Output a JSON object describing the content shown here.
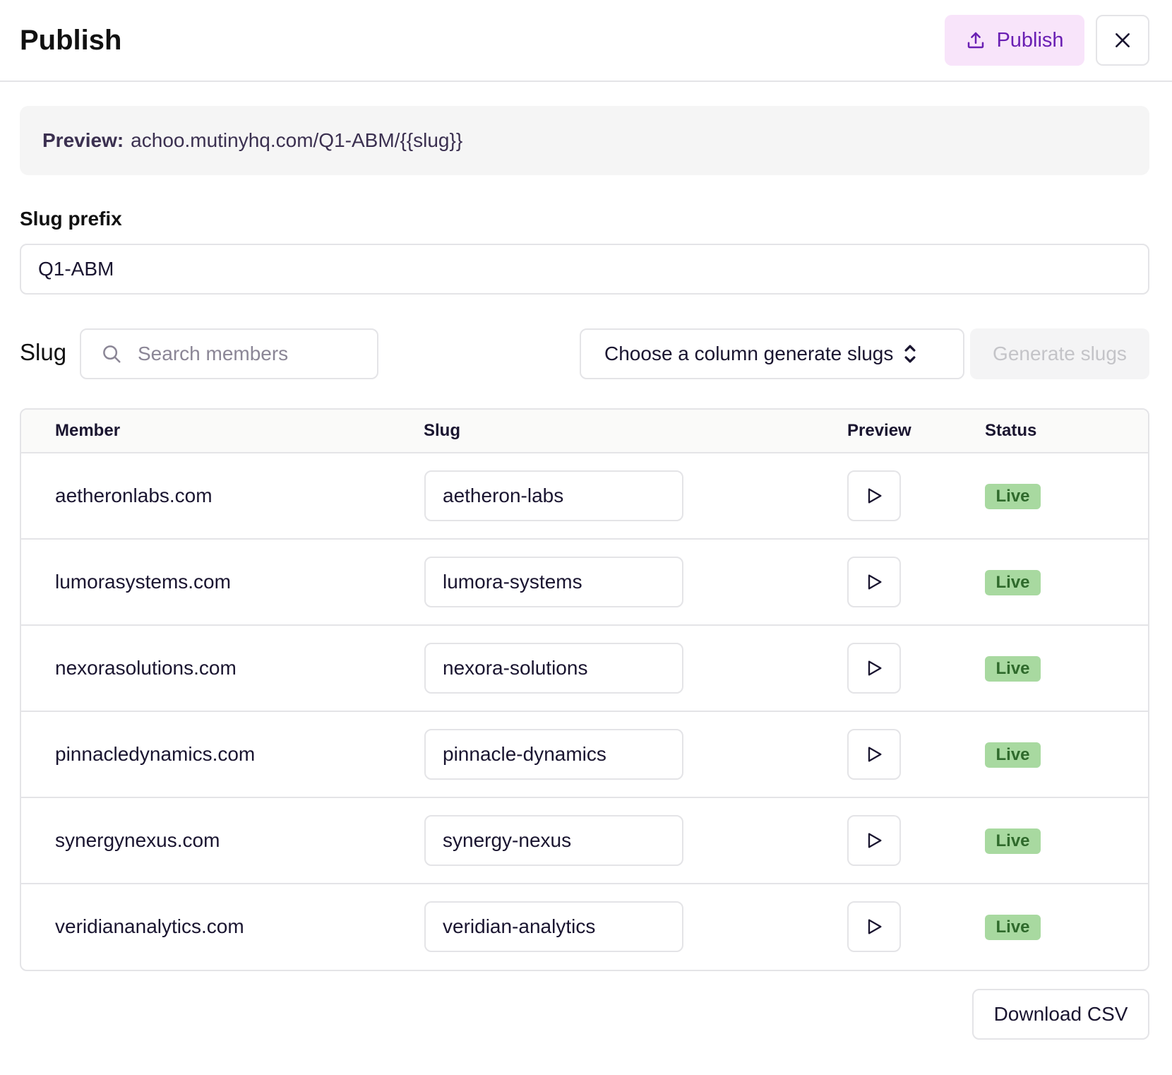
{
  "header": {
    "title": "Publish",
    "publish_label": "Publish",
    "publish_icon": "upload-icon",
    "close_icon": "close-icon"
  },
  "preview": {
    "label": "Preview:",
    "url": "achoo.mutinyhq.com/Q1-ABM/{{slug}}"
  },
  "slug_prefix": {
    "label": "Slug prefix",
    "value": "Q1-ABM"
  },
  "slug_toolbar": {
    "label": "Slug",
    "search_placeholder": "Search members",
    "search_icon": "search-icon",
    "column_select_label": "Choose a column generate slugs",
    "column_select_icon": "chevron-up-down-icon",
    "generate_label": "Generate slugs"
  },
  "table": {
    "columns": [
      "Member",
      "Slug",
      "Preview",
      "Status"
    ],
    "rows": [
      {
        "member": "aetheronlabs.com",
        "slug": "aetheron-labs",
        "status": "Live"
      },
      {
        "member": "lumorasystems.com",
        "slug": "lumora-systems",
        "status": "Live"
      },
      {
        "member": "nexorasolutions.com",
        "slug": "nexora-solutions",
        "status": "Live"
      },
      {
        "member": "pinnacledynamics.com",
        "slug": "pinnacle-dynamics",
        "status": "Live"
      },
      {
        "member": "synergynexus.com",
        "slug": "synergy-nexus",
        "status": "Live"
      },
      {
        "member": "veridiananalytics.com",
        "slug": "veridian-analytics",
        "status": "Live"
      }
    ],
    "preview_icon": "play-icon"
  },
  "footer": {
    "download_label": "Download CSV"
  },
  "colors": {
    "accent_text": "#6a1fb3",
    "accent_bg": "#f8e4fa",
    "live_bg": "#a8d9a0",
    "live_text": "#2f6a2c",
    "border": "#e4e4e7"
  }
}
